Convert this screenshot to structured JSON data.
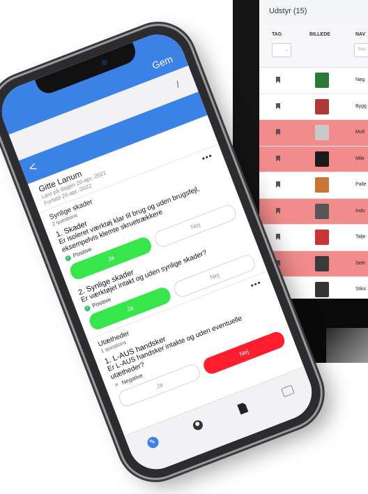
{
  "table": {
    "title": "Udstyr (15)",
    "columns": [
      "TAG",
      "BILLEDE",
      "NAV"
    ],
    "name_filter_placeholder": "Søg",
    "rows": [
      {
        "name": "Nøg",
        "highlight": false,
        "thumb_color": "#2b7a3a"
      },
      {
        "name": "Bygg",
        "highlight": false,
        "thumb_color": "#b03a3a"
      },
      {
        "name": "Mult",
        "highlight": true,
        "thumb_color": "#c9c9c9"
      },
      {
        "name": "Mikr",
        "highlight": true,
        "thumb_color": "#1a1a1a"
      },
      {
        "name": "Palle",
        "highlight": false,
        "thumb_color": "#c87533"
      },
      {
        "name": "Indu",
        "highlight": true,
        "thumb_color": "#555555"
      },
      {
        "name": "Talje",
        "highlight": false,
        "thumb_color": "#cc3333"
      },
      {
        "name": "Sele",
        "highlight": true,
        "thumb_color": "#3a3a3a"
      },
      {
        "name": "Stiks",
        "highlight": false,
        "thumb_color": "#333333"
      }
    ]
  },
  "phone": {
    "save_label": "Gem",
    "back_symbol": "<",
    "user_name": "Gitte Lanum",
    "meta_line1": "Løst på dagen 20-apr.-2021",
    "meta_line2": "Forfald 20-apr.-2022",
    "menu_dots": "•••",
    "sections": [
      {
        "title": "Synlige skader",
        "count": "2 questions",
        "questions": [
          {
            "title": "1. Skader",
            "text": "Er isoleret værktøj klar til brug og uden brugsfejl, eksempelvis klemte skruetrækkere",
            "status": "Positive",
            "status_type": "pos",
            "yes_label": "Ja",
            "no_label": "Nej",
            "selected": "yes"
          },
          {
            "title": "2. Synlige skader",
            "text": "Er værktøjet intakt og uden synlige skader?",
            "status": "Positive",
            "status_type": "pos",
            "yes_label": "Ja",
            "no_label": "Nej",
            "selected": "yes"
          }
        ]
      },
      {
        "title": "Utætheder",
        "count": "1 questions",
        "questions": [
          {
            "title": "1. L-AUS handsker",
            "text": "Er L-AUS handsker intakte og uden eventuelle utætheder?",
            "status": "Negative",
            "status_type": "neg",
            "yes_label": "Ja",
            "no_label": "Nej",
            "selected": "no"
          }
        ]
      }
    ],
    "colors": {
      "accent": "#3b82e6",
      "yes": "#36e64a",
      "no": "#ff1e2d",
      "highlight_row": "#f28b8b"
    },
    "tabbar_icons": [
      "wrench-icon",
      "user-icon",
      "document-icon",
      "card-icon"
    ]
  }
}
